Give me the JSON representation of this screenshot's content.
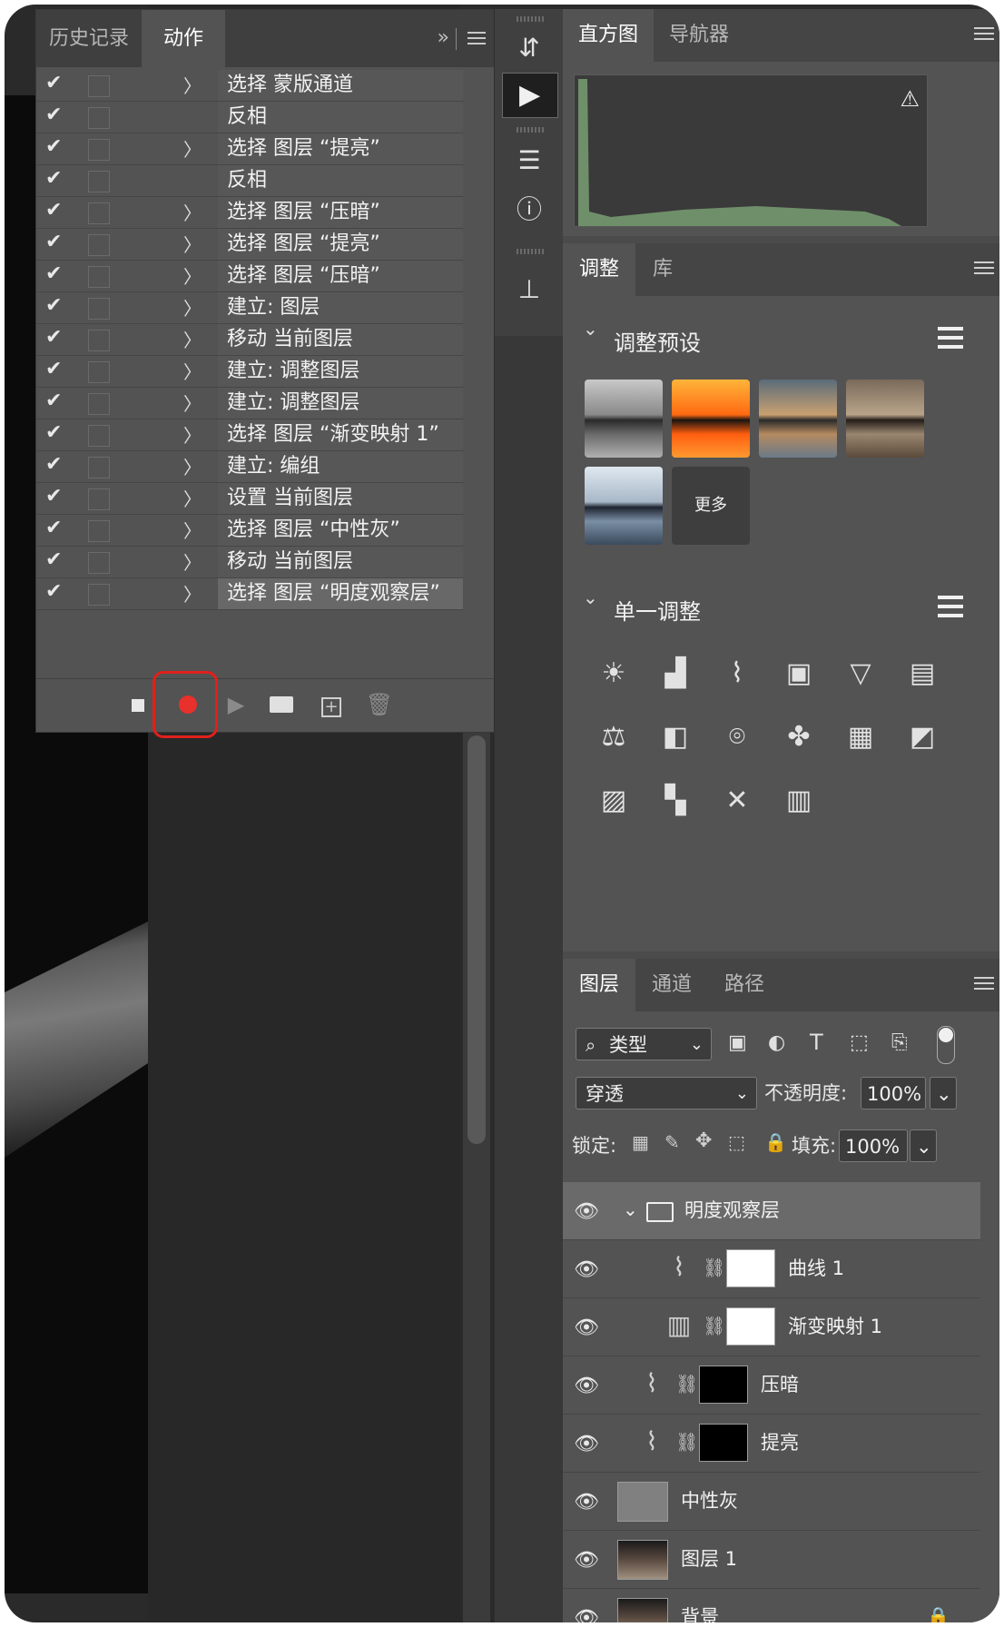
{
  "actions_panel": {
    "tabs": [
      {
        "label": "历史记录"
      },
      {
        "label": "动作"
      }
    ],
    "expand_icon": "double-chevron-right-icon",
    "menu_icon": "menu-icon",
    "rows": [
      {
        "label": "选择 蒙版通道",
        "has_arrow": true
      },
      {
        "label": "反相",
        "has_arrow": false
      },
      {
        "label": "选择 图层 “提亮”",
        "has_arrow": true
      },
      {
        "label": "反相",
        "has_arrow": false
      },
      {
        "label": "选择 图层 “压暗”",
        "has_arrow": true
      },
      {
        "label": "选择 图层 “提亮”",
        "has_arrow": true
      },
      {
        "label": "选择 图层 “压暗”",
        "has_arrow": true
      },
      {
        "label": "建立: 图层",
        "has_arrow": true
      },
      {
        "label": "移动 当前图层",
        "has_arrow": true
      },
      {
        "label": "建立: 调整图层",
        "has_arrow": true
      },
      {
        "label": "建立: 调整图层",
        "has_arrow": true
      },
      {
        "label": "选择 图层 “渐变映射 1”",
        "has_arrow": true
      },
      {
        "label": "建立: 编组",
        "has_arrow": true
      },
      {
        "label": "设置 当前图层",
        "has_arrow": true
      },
      {
        "label": "选择 图层 “中性灰”",
        "has_arrow": true
      },
      {
        "label": "移动 当前图层",
        "has_arrow": true
      },
      {
        "label": "选择 图层 “明度观察层”",
        "has_arrow": true,
        "selected": true
      }
    ],
    "check_glyph": "✔",
    "arrow_glyph": "〉",
    "bottom_icons": [
      "stop-icon",
      "record-icon",
      "play-icon",
      "folder-icon",
      "new-action-icon",
      "trash-icon"
    ]
  },
  "histogram_panel": {
    "tabs": [
      {
        "label": "直方图"
      },
      {
        "label": "导航器"
      }
    ],
    "warning_icon": "warning-icon",
    "histogram_color": "#6f8f6a"
  },
  "adjustments_panel": {
    "tabs": [
      {
        "label": "调整"
      },
      {
        "label": "库"
      }
    ],
    "presets_title": "调整预设",
    "more_label": "更多",
    "single_title": "单一调整",
    "preset_thumbs": [
      "gray",
      "orange",
      "warm",
      "sepia",
      "blue"
    ],
    "adjust_icons": [
      "brightness-icon",
      "levels-icon",
      "curves-icon",
      "exposure-icon",
      "vibrance-icon",
      "hue-saturation-icon",
      "color-balance-icon",
      "black-white-icon",
      "photo-filter-icon",
      "channel-mixer-icon",
      "color-lookup-icon",
      "invert-icon",
      "posterize-icon",
      "threshold-icon",
      "selective-color-icon",
      "gradient-map-icon"
    ]
  },
  "layers_panel": {
    "tabs": [
      {
        "label": "图层"
      },
      {
        "label": "通道"
      },
      {
        "label": "路径"
      }
    ],
    "filter_label": "类型",
    "blend_mode": "穿透",
    "opacity_label": "不透明度:",
    "opacity_value": "100%",
    "lock_label": "锁定:",
    "fill_label": "填充:",
    "fill_value": "100%",
    "layers": [
      {
        "name": "明度观察层",
        "kind": "group"
      },
      {
        "name": "曲线 1",
        "kind": "adjust-curves",
        "mask": "white",
        "indent": 2
      },
      {
        "name": "渐变映射 1",
        "kind": "adjust-gradient",
        "mask": "white",
        "indent": 2
      },
      {
        "name": "压暗",
        "kind": "adjust-curves",
        "mask": "black",
        "indent": 1
      },
      {
        "name": "提亮",
        "kind": "adjust-curves",
        "mask": "black",
        "indent": 1
      },
      {
        "name": "中性灰",
        "kind": "fill-gray"
      },
      {
        "name": "图层 1",
        "kind": "photo"
      },
      {
        "name": "背景",
        "kind": "photo",
        "locked": true
      }
    ]
  }
}
